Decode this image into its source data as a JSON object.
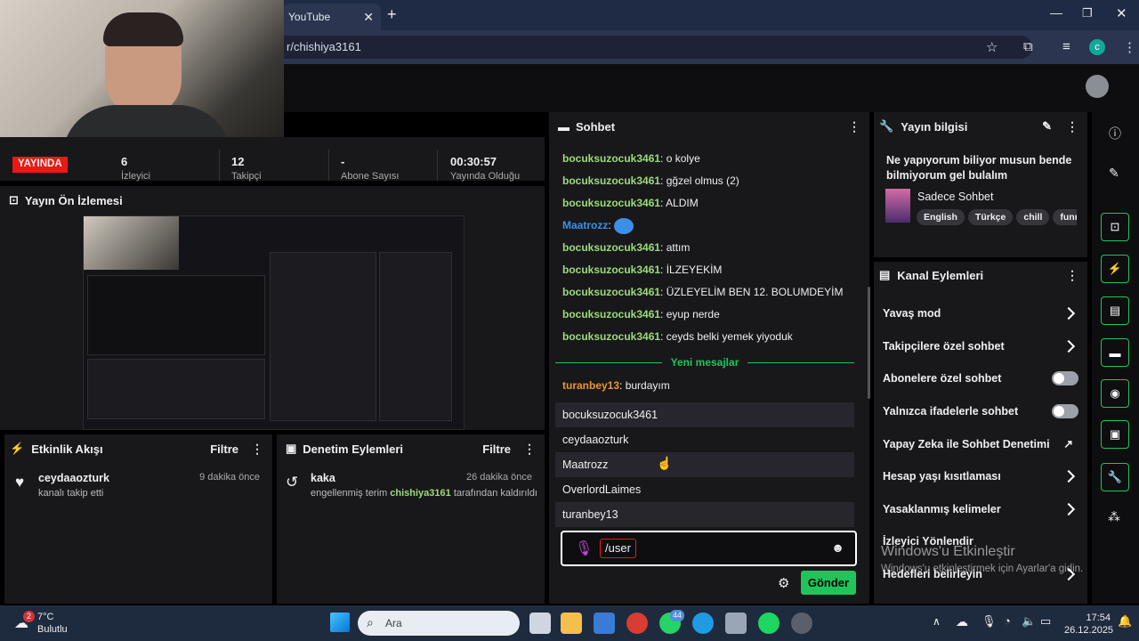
{
  "browser": {
    "tab_title": "YouTube",
    "url": "r/chishiya3161"
  },
  "stats": {
    "live_badge": "YAYINDA",
    "values": [
      "6",
      "12",
      "-",
      "00:30:57"
    ],
    "labels": [
      "İzleyici",
      "Takipçi",
      "Abone Sayısı",
      "Yayında Olduğu"
    ]
  },
  "preview": {
    "title": "Yayın Ön İzlemesi"
  },
  "activity": {
    "title": "Etkinlik Akışı",
    "filter": "Filtre",
    "items": [
      {
        "user": "ceydaaozturk",
        "text": "kanalı takip etti",
        "time": "9 dakika önce"
      }
    ]
  },
  "moderation": {
    "title": "Denetim Eylemleri",
    "filter": "Filtre",
    "items": [
      {
        "user": "kaka",
        "text_before": "engellenmiş terim ",
        "moderator": "chishiya3161",
        "text_after": " tarafından kaldırıldı",
        "time": "26 dakika önce"
      }
    ]
  },
  "chat": {
    "title": "Sohbet",
    "messages": [
      {
        "user": "bocuksuzocuk3461",
        "text": "o kolye"
      },
      {
        "user": "bocuksuzocuk3461",
        "text": "gğzel olmus (2)"
      },
      {
        "user": "bocuksuzocuk3461",
        "text": "ALDIM"
      },
      {
        "user": "Maatrozz",
        "text": ""
      },
      {
        "user": "bocuksuzocuk3461",
        "text": "attım"
      },
      {
        "user": "bocuksuzocuk3461",
        "text": "İLZEYEKİM"
      },
      {
        "user": "bocuksuzocuk3461",
        "text": "ÜZLEYELİM BEN 12. BOLUMDEYİM"
      },
      {
        "user": "bocuksuzocuk3461",
        "text": "eyup nerde"
      },
      {
        "user": "bocuksuzocuk3461",
        "text": "ceyds belki yemek yiyoduk"
      }
    ],
    "new_messages_label": "Yeni mesajlar",
    "new_message": {
      "user": "turanbey13",
      "text": "burdayım"
    },
    "suggestions": [
      "bocuksuzocuk3461",
      "ceydaaozturk",
      "Maatrozz",
      "OverlordLaimes",
      "turanbey13"
    ],
    "input_value": "/user",
    "send_label": "Gönder"
  },
  "stream_info": {
    "title": "Yayın bilgisi",
    "stream_title": "Ne yapıyorum biliyor musun bende bilmiyorum gel bulalım",
    "category": "Sadece Sohbet",
    "tags": [
      "English",
      "Türkçe",
      "chill",
      "funny"
    ]
  },
  "channel_actions": {
    "title": "Kanal Eylemleri",
    "items": [
      {
        "label": "Yavaş mod",
        "control": "chevron"
      },
      {
        "label": "Takipçilere özel sohbet",
        "control": "chevron"
      },
      {
        "label": "Abonelere özel sohbet",
        "control": "toggle"
      },
      {
        "label": "Yalnızca ifadelerle sohbet",
        "control": "toggle"
      },
      {
        "label": "Yapay Zeka ile Sohbet Denetimi",
        "control": "external"
      },
      {
        "label": "Hesap yaşı kısıtlaması",
        "control": "chevron"
      },
      {
        "label": "Yasaklanmış kelimeler",
        "control": "chevron"
      },
      {
        "label": "İzleyici Yönlendir",
        "control": "none"
      },
      {
        "label": "Hedefleri belirleyin",
        "control": "chevron"
      }
    ]
  },
  "watermark": {
    "line1": "Windows'u Etkinleştir",
    "line2": "Windows'u etkinleştirmek için Ayarlar'a gidin."
  },
  "taskbar": {
    "weather_temp": "7°C",
    "weather_desc": "Bulutlu",
    "weather_badge": "2",
    "search_placeholder": "Ara",
    "whatsapp_badge": "44",
    "time": "17:54",
    "date": "26.12.2025"
  },
  "colors": {
    "accent": "#21c45a",
    "live": "#e91916",
    "chat_user": "#9cdb7b"
  }
}
